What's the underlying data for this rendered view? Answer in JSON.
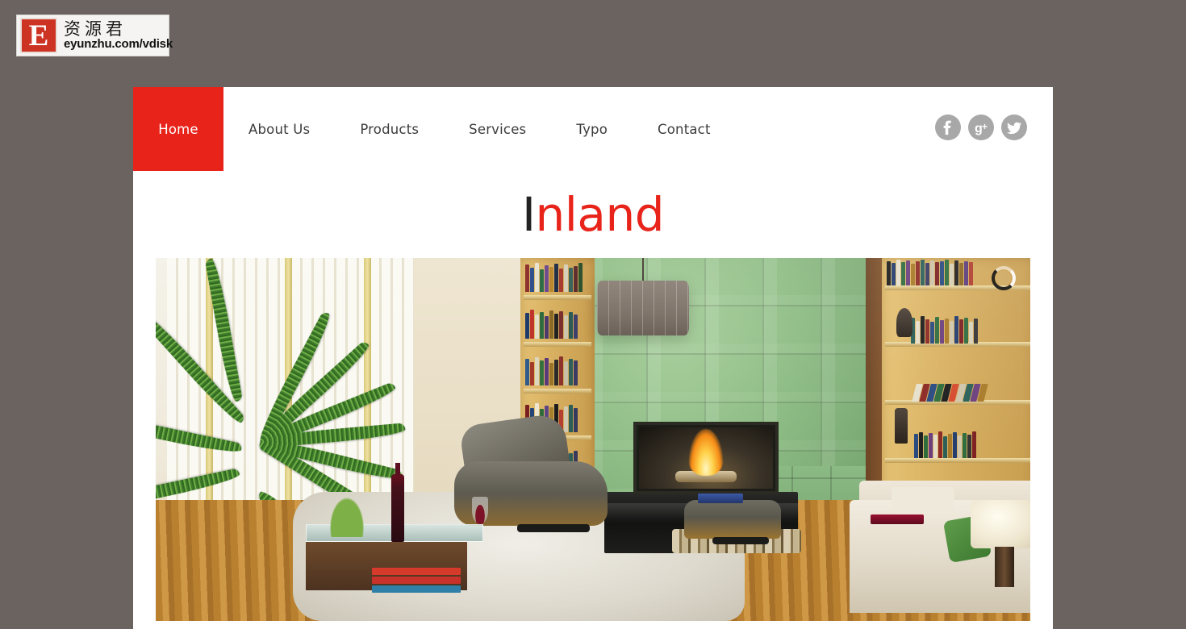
{
  "watermark": {
    "logo_letter": "E",
    "cn_text": "资源君",
    "url": "eyunzhu.com/vdisk"
  },
  "colors": {
    "background": "#6b6360",
    "accent_red": "#e8231a",
    "page_bg": "#ffffff",
    "social_circle": "#a8a8a8",
    "title_dark": "#232323"
  },
  "header": {
    "nav": [
      {
        "label": "Home",
        "active": true
      },
      {
        "label": "About Us",
        "active": false
      },
      {
        "label": "Products",
        "active": false
      },
      {
        "label": "Services",
        "active": false
      },
      {
        "label": "Typo",
        "active": false
      },
      {
        "label": "Contact",
        "active": false
      }
    ],
    "social": [
      {
        "name": "facebook-icon",
        "glyph": "f"
      },
      {
        "name": "google-plus-icon",
        "glyph": "g+"
      },
      {
        "name": "twitter-icon",
        "glyph": "twitter-bird"
      }
    ]
  },
  "title": {
    "first_letter": "I",
    "rest": "nland",
    "full": "Inland"
  },
  "slider": {
    "spinner_name": "loading-spinner",
    "image_alt": "modern living room with green padded wall, fireplace, bookshelves, palm plant and lounge chair"
  }
}
